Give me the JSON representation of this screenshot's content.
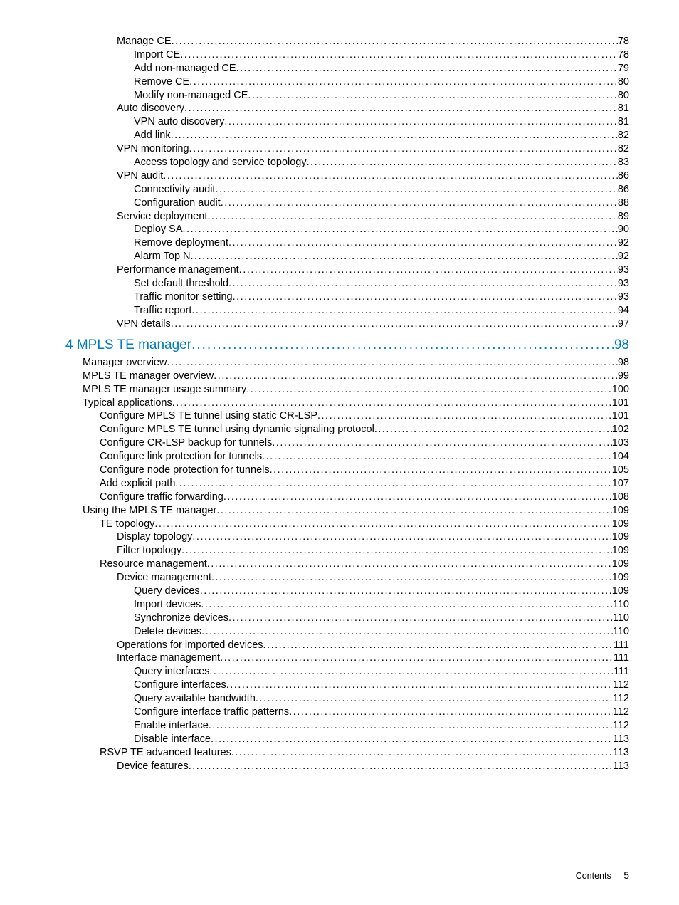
{
  "toc": [
    {
      "title": "Manage CE",
      "page": 78,
      "level": 3
    },
    {
      "title": "Import CE",
      "page": 78,
      "level": 4
    },
    {
      "title": "Add non-managed CE",
      "page": 79,
      "level": 4
    },
    {
      "title": "Remove CE",
      "page": 80,
      "level": 4
    },
    {
      "title": "Modify non-managed CE",
      "page": 80,
      "level": 4
    },
    {
      "title": "Auto discovery",
      "page": 81,
      "level": 3
    },
    {
      "title": "VPN auto discovery",
      "page": 81,
      "level": 4
    },
    {
      "title": "Add link",
      "page": 82,
      "level": 4
    },
    {
      "title": "VPN monitoring",
      "page": 82,
      "level": 3
    },
    {
      "title": "Access topology and service topology",
      "page": 83,
      "level": 4
    },
    {
      "title": "VPN audit",
      "page": 86,
      "level": 3
    },
    {
      "title": "Connectivity audit",
      "page": 86,
      "level": 4
    },
    {
      "title": "Configuration audit",
      "page": 88,
      "level": 4
    },
    {
      "title": "Service deployment",
      "page": 89,
      "level": 3
    },
    {
      "title": "Deploy SA",
      "page": 90,
      "level": 4
    },
    {
      "title": "Remove deployment",
      "page": 92,
      "level": 4
    },
    {
      "title": "Alarm Top N",
      "page": 92,
      "level": 4
    },
    {
      "title": "Performance management",
      "page": 93,
      "level": 3
    },
    {
      "title": "Set default threshold",
      "page": 93,
      "level": 4
    },
    {
      "title": "Traffic monitor setting",
      "page": 93,
      "level": 4
    },
    {
      "title": "Traffic report",
      "page": 94,
      "level": 4
    },
    {
      "title": "VPN details",
      "page": 97,
      "level": 3
    },
    {
      "title": "4 MPLS TE manager",
      "page": 98,
      "level": 0,
      "chapter": true
    },
    {
      "title": "Manager overview",
      "page": 98,
      "level": 1
    },
    {
      "title": "MPLS TE manager overview",
      "page": 99,
      "level": 1
    },
    {
      "title": "MPLS TE manager usage summary",
      "page": 100,
      "level": 1
    },
    {
      "title": "Typical applications",
      "page": 101,
      "level": 1
    },
    {
      "title": "Configure MPLS TE tunnel using static CR-LSP",
      "page": 101,
      "level": 2
    },
    {
      "title": "Configure MPLS TE tunnel using dynamic signaling protocol",
      "page": 102,
      "level": 2
    },
    {
      "title": "Configure CR-LSP backup for tunnels",
      "page": 103,
      "level": 2
    },
    {
      "title": "Configure link protection for tunnels",
      "page": 104,
      "level": 2
    },
    {
      "title": "Configure node protection for tunnels",
      "page": 105,
      "level": 2
    },
    {
      "title": "Add explicit path",
      "page": 107,
      "level": 2
    },
    {
      "title": "Configure traffic forwarding",
      "page": 108,
      "level": 2
    },
    {
      "title": "Using the MPLS TE manager",
      "page": 109,
      "level": 1
    },
    {
      "title": "TE topology",
      "page": 109,
      "level": 2
    },
    {
      "title": "Display topology",
      "page": 109,
      "level": 3
    },
    {
      "title": "Filter topology",
      "page": 109,
      "level": 3
    },
    {
      "title": "Resource management",
      "page": 109,
      "level": 2
    },
    {
      "title": "Device management",
      "page": 109,
      "level": 3
    },
    {
      "title": "Query devices",
      "page": 109,
      "level": 4
    },
    {
      "title": "Import devices",
      "page": 110,
      "level": 4
    },
    {
      "title": "Synchronize devices",
      "page": 110,
      "level": 4
    },
    {
      "title": "Delete devices",
      "page": 110,
      "level": 4
    },
    {
      "title": "Operations for imported devices",
      "page": 111,
      "level": 3
    },
    {
      "title": "Interface management",
      "page": 111,
      "level": 3
    },
    {
      "title": "Query interfaces",
      "page": 111,
      "level": 4
    },
    {
      "title": "Configure interfaces",
      "page": 112,
      "level": 4
    },
    {
      "title": "Query available bandwidth",
      "page": 112,
      "level": 4
    },
    {
      "title": "Configure interface traffic patterns",
      "page": 112,
      "level": 4
    },
    {
      "title": "Enable interface",
      "page": 112,
      "level": 4
    },
    {
      "title": "Disable interface",
      "page": 113,
      "level": 4
    },
    {
      "title": "RSVP TE advanced features",
      "page": 113,
      "level": 2
    },
    {
      "title": "Device features",
      "page": 113,
      "level": 3
    }
  ],
  "footer": {
    "label": "Contents",
    "page": "5"
  }
}
